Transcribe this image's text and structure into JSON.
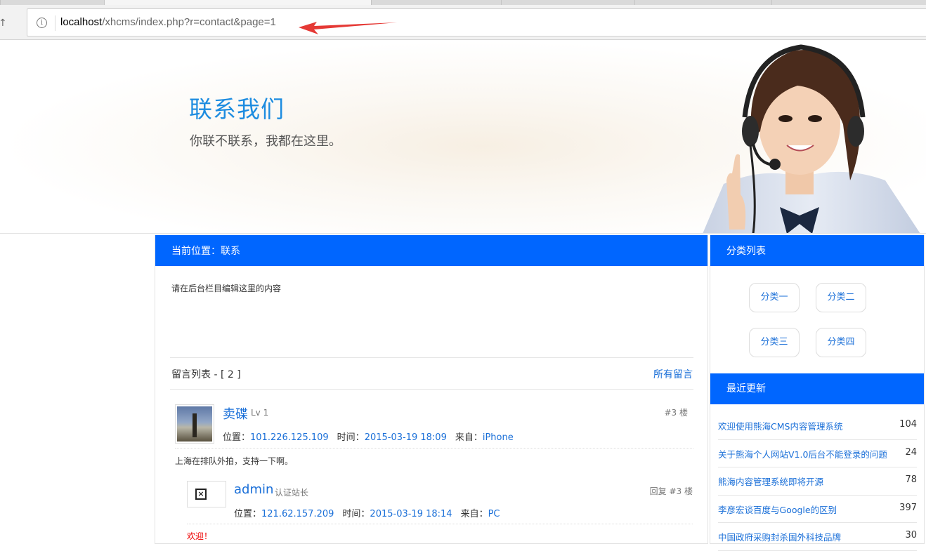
{
  "browser": {
    "url_host": "localhost",
    "url_path": "/xhcms/index.php?r=contact&page=1"
  },
  "banner": {
    "title": "联系我们",
    "subtitle": "你联不联系，我都在这里。"
  },
  "main": {
    "header": "当前位置：联系",
    "content": "请在后台栏目编辑这里的内容",
    "comments_label": "留言列表 - [ 2 ]",
    "all_comments_link": "所有留言",
    "comment": {
      "name": "卖碟",
      "level": "Lv 1",
      "floor": "#3 楼",
      "loc_label": "位置：",
      "loc": "101.226.125.109",
      "time_label": "时间：",
      "time": "2015-03-19 18:09",
      "from_label": "来自：",
      "from": "iPhone",
      "text": "上海在排队外拍，支持一下啊。"
    },
    "reply": {
      "name": "admin",
      "role": "认证站长",
      "floor": "回复 #3 楼",
      "loc_label": "位置：",
      "loc": "121.62.157.209",
      "time_label": "时间：",
      "time": "2015-03-19 18:14",
      "from_label": "来自：",
      "from": "PC",
      "text": "欢迎！"
    }
  },
  "side": {
    "categories_header": "分类列表",
    "categories": [
      "分类一",
      "分类二",
      "分类三",
      "分类四"
    ],
    "recent_header": "最近更新",
    "recent": [
      {
        "title": "欢迎使用熊海CMS内容管理系统",
        "count": "104"
      },
      {
        "title": "关于熊海个人网站V1.0后台不能登录的问题",
        "count": "24"
      },
      {
        "title": "熊海内容管理系统即将开源",
        "count": "78"
      },
      {
        "title": "李彦宏谈百度与Google的区别",
        "count": "397"
      },
      {
        "title": "中国政府采购封杀国外科技品牌",
        "count": "30"
      }
    ]
  },
  "colors": {
    "primary": "#0066ff",
    "link": "#1a6fd8",
    "title_blue": "#1d8ce0",
    "annotation_red": "#e53935"
  }
}
